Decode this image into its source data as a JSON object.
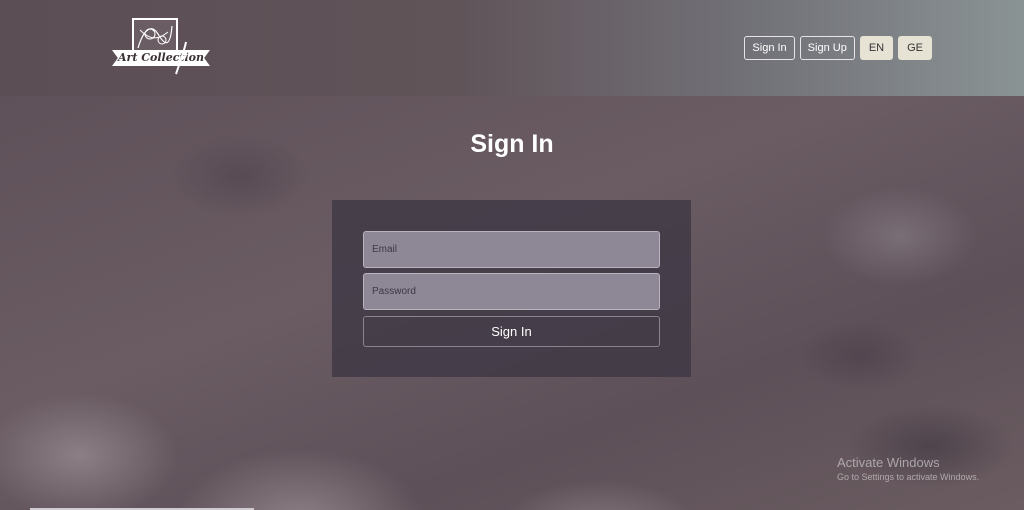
{
  "header": {
    "logo_text": "Art Collection",
    "nav": {
      "sign_in": "Sign In",
      "sign_up": "Sign Up",
      "lang_en": "EN",
      "lang_ge": "GE"
    }
  },
  "main": {
    "title": "Sign In",
    "form": {
      "email_placeholder": "Email",
      "password_placeholder": "Password",
      "submit_label": "Sign In"
    }
  },
  "watermark": {
    "title": "Activate Windows",
    "subtitle": "Go to Settings to activate Windows."
  },
  "colors": {
    "header_start": "#5b4e55",
    "header_end": "#8a9394",
    "lang_button": "#e6e2d4",
    "panel": "#3e3844"
  }
}
